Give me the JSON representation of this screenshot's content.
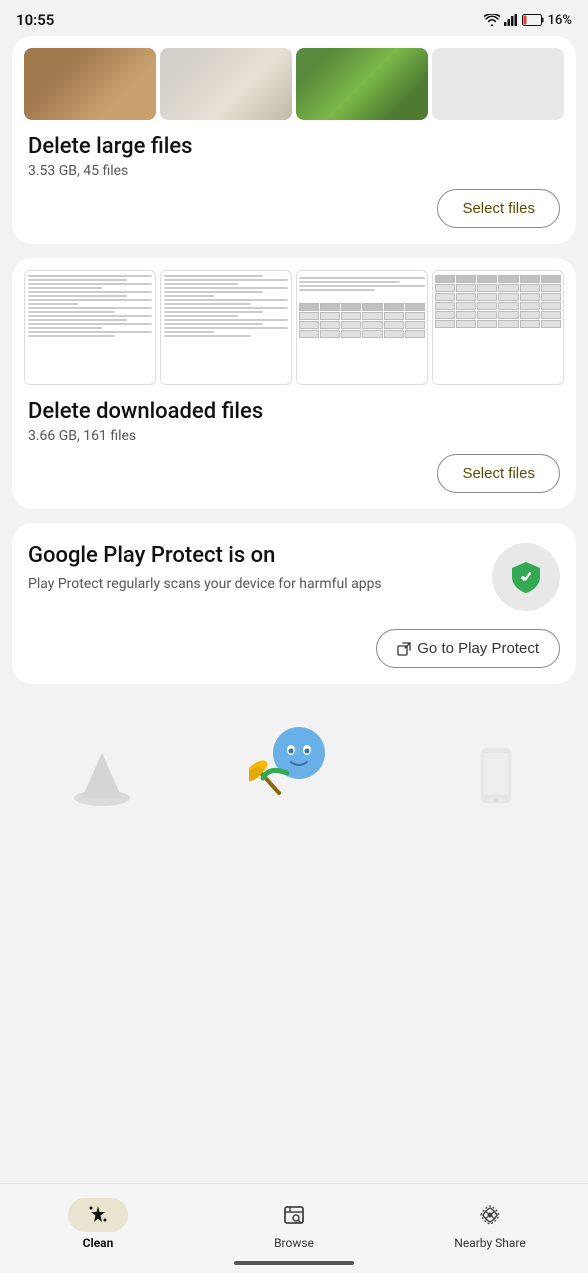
{
  "statusBar": {
    "time": "10:55",
    "battery": "16%",
    "wifi": true,
    "signal": true
  },
  "cards": [
    {
      "id": "large-files",
      "title": "Delete large files",
      "subtitle": "3.53 GB, 45 files",
      "selectLabel": "Select files",
      "thumbs": [
        "photo1",
        "photo2",
        "photo3",
        "blank"
      ]
    },
    {
      "id": "downloaded-files",
      "title": "Delete downloaded files",
      "subtitle": "3.66 GB, 161 files",
      "selectLabel": "Select files",
      "thumbs": [
        "doc1",
        "doc2",
        "doc3",
        "doc4"
      ]
    }
  ],
  "protectCard": {
    "title": "Google Play Protect is on",
    "subtitle": "Play Protect regularly scans your device for harmful apps",
    "actionLabel": "Go to Play Protect"
  },
  "bottomNav": {
    "items": [
      {
        "id": "clean",
        "label": "Clean",
        "active": true
      },
      {
        "id": "browse",
        "label": "Browse",
        "active": false
      },
      {
        "id": "nearby-share",
        "label": "Nearby Share",
        "active": false
      }
    ]
  }
}
